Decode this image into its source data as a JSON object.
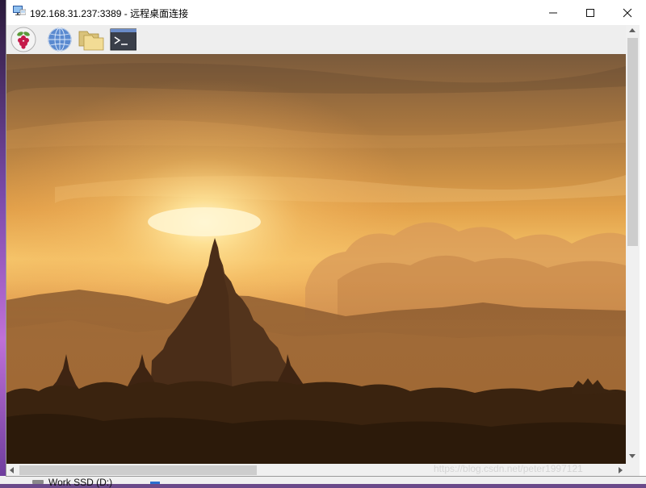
{
  "window": {
    "title": "192.168.31.237:3389 - 远程桌面连接"
  },
  "toolbar": {
    "icons": [
      "raspberry-pi-icon",
      "web-browser-icon",
      "file-manager-icon",
      "terminal-icon"
    ]
  },
  "remote_desktop": {
    "wallpaper": "sunset-pagoda-landscape"
  },
  "taskbar": {
    "drive_label": "Work SSD (D:)"
  },
  "watermark": "https://blog.csdn.net/peter1997121",
  "colors": {
    "titlebar": "#ffffff",
    "toolbar": "#eeeeee",
    "scrollbar": "#f0f0f0",
    "sky_top": "#7a5a3c",
    "sun_glow": "#fff2c0"
  }
}
